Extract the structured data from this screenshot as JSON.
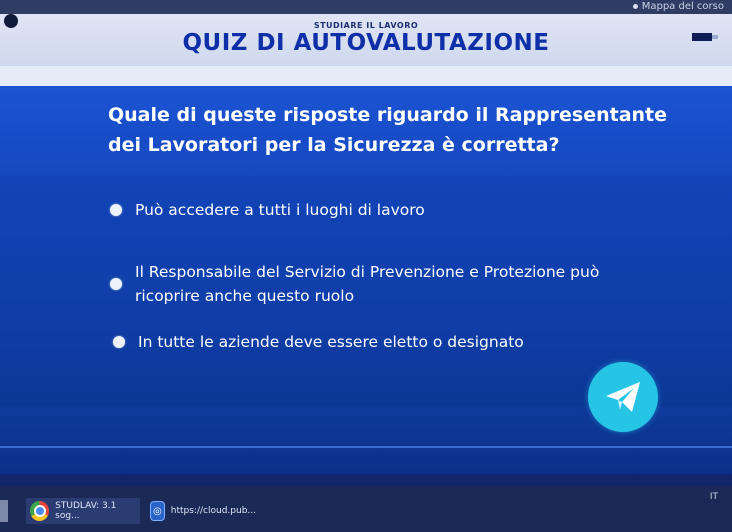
{
  "top_link": "Mappa del corso",
  "header": {
    "subtitle": "STUDIARE IL LAVORO",
    "title": "QUIZ DI AUTOVALUTAZIONE",
    "progress": 0.75
  },
  "question": "Quale di queste risposte riguardo il Rappresentante dei Lavoratori per la Sicurezza è corretta?",
  "answers": [
    {
      "text": "Può accedere a tutti i luoghi di lavoro"
    },
    {
      "text": "Il Responsabile del Servizio di Prevenzione e Protezione può ricoprire anche questo  ruolo"
    },
    {
      "text": "In tutte le aziende deve essere eletto o designato"
    }
  ],
  "send_icon": "paper-plane-icon",
  "taskbar": {
    "items": [
      {
        "label": "STUDLAV: 3.1 sog...",
        "icon": "chrome-icon"
      },
      {
        "label": "https://cloud.pub...",
        "icon": "web-icon"
      }
    ],
    "tray_text": "IT"
  },
  "colors": {
    "header_title": "#0f2fa8",
    "question_band": "#1b54d2",
    "send_button": "#26c4e5"
  }
}
